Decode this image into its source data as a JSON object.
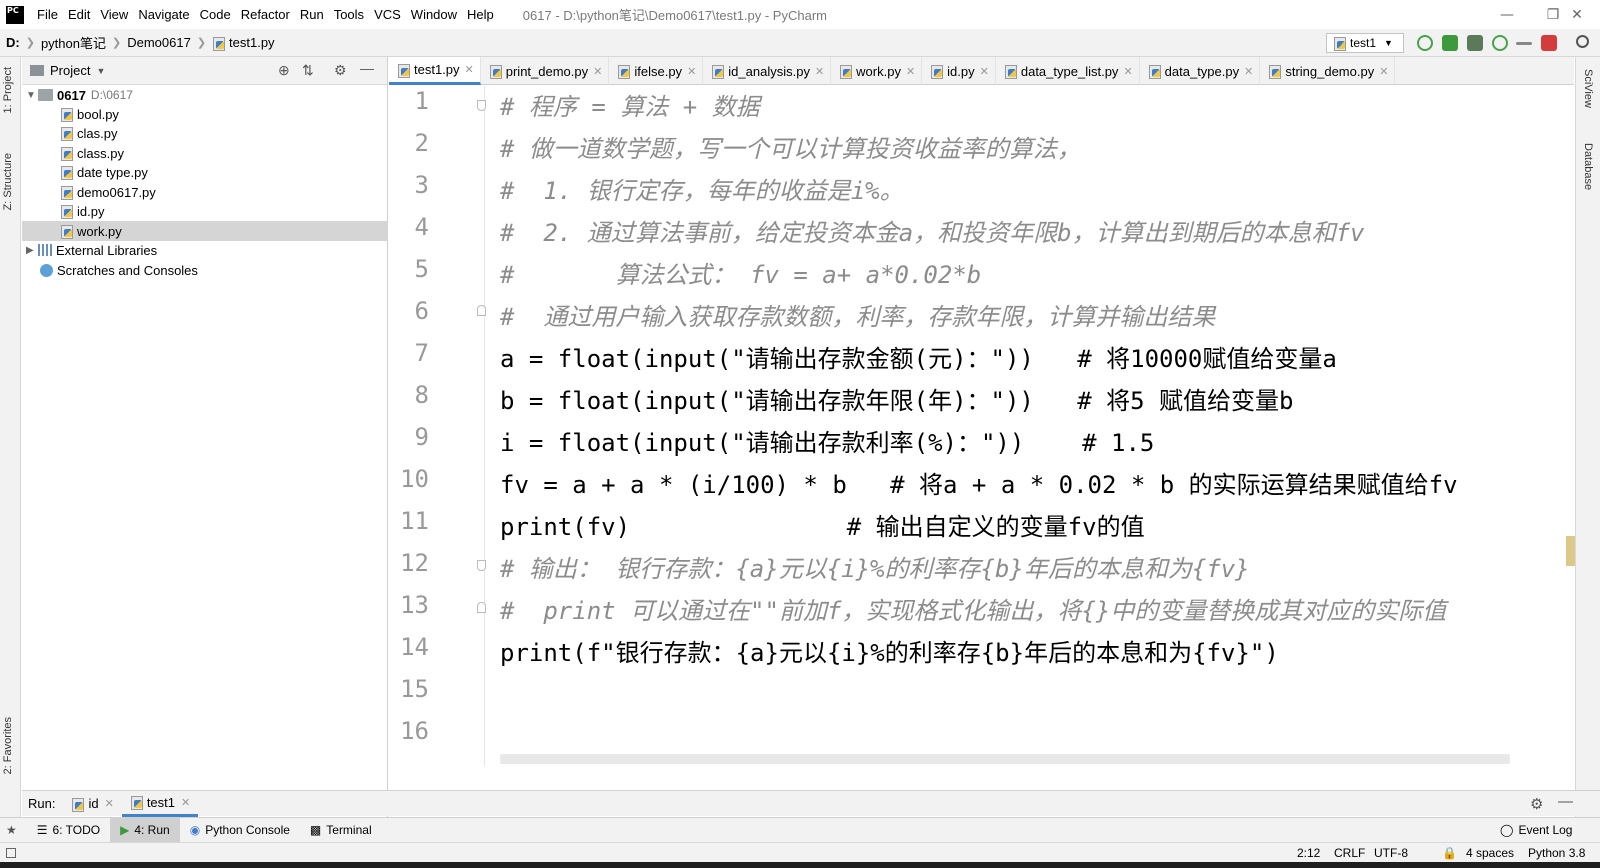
{
  "app": {
    "logo_text": "PC",
    "window_title": "0617 - D:\\python笔记\\Demo0617\\test1.py - PyCharm",
    "menu": [
      "File",
      "Edit",
      "View",
      "Navigate",
      "Code",
      "Refactor",
      "Run",
      "Tools",
      "VCS",
      "Window",
      "Help"
    ]
  },
  "navbar": {
    "crumbs": [
      "D:",
      "python笔记",
      "Demo0617",
      "test1.py"
    ],
    "run_config": "test1"
  },
  "left_stripe": {
    "project": "1: Project",
    "structure": "Z: Structure",
    "favorites": "2: Favorites"
  },
  "right_stripe": {
    "sciview": "SciView",
    "database": "Database"
  },
  "project": {
    "header": "Project",
    "root_name": "0617",
    "root_path": "D:\\0617",
    "files": [
      "bool.py",
      "clas.py",
      "class.py",
      "date type.py",
      "demo0617.py",
      "id.py",
      "work.py"
    ],
    "selected": "work.py",
    "external_libraries": "External Libraries",
    "scratches": "Scratches and Consoles"
  },
  "tabs": [
    "test1.py",
    "print_demo.py",
    "ifelse.py",
    "id_analysis.py",
    "work.py",
    "id.py",
    "data_type_list.py",
    "data_type.py",
    "string_demo.py"
  ],
  "active_tab": "test1.py",
  "editor": {
    "line_numbers": [
      "1",
      "2",
      "3",
      "4",
      "5",
      "6",
      "7",
      "8",
      "9",
      "10",
      "11",
      "12",
      "13",
      "14",
      "15",
      "16"
    ],
    "current_line": "11",
    "lines": [
      "# 程序 = 算法 + 数据",
      "# 做一道数学题，写一个可以计算投资收益率的算法，",
      "#  1. 银行定存，每年的收益是i%。",
      "#  2. 通过算法事前，给定投资本金a，和投资年限b，计算出到期后的本息和fv",
      "#       算法公式： fv = a+ a*0.02*b",
      "#  通过用户输入获取存款数额，利率，存款年限，计算并输出结果",
      "a = float(input(\"请输出存款金额(元)：\"))   # 将10000赋值给变量a",
      "b = float(input(\"请输出存款年限(年)：\"))   # 将5 赋值给变量b",
      "i = float(input(\"请输出存款利率(%)：\"))    # 1.5",
      "fv = a + a * (i/100) * b   # 将a + a * 0.02 * b 的实际运算结果赋值给fv",
      "print(fv)               # 输出自定义的变量fv的值",
      "# 输出： 银行存款：{a}元以{i}%的利率存{b}年后的本息和为{fv}",
      "#  print 可以通过在\"\"前加f，实现格式化输出，将{}中的变量替换成其对应的实际值",
      "print(f\"银行存款：{a}元以{i}%的利率存{b}年后的本息和为{fv}\")",
      "",
      ""
    ]
  },
  "run_bar": {
    "label": "Run:",
    "tabs": [
      "id",
      "test1"
    ]
  },
  "tool_bar": {
    "items": [
      "6: TODO",
      "4: Run",
      "Python Console",
      "Terminal"
    ],
    "event_log": "Event Log"
  },
  "status": {
    "position": "2:12",
    "line_sep": "CRLF",
    "encoding": "UTF-8",
    "indent": "4 spaces",
    "interpreter": "Python 3.8"
  },
  "colors": {
    "accent": "#4083c9",
    "selection": "#d5d5d5",
    "current_line": "#fcfaed"
  }
}
